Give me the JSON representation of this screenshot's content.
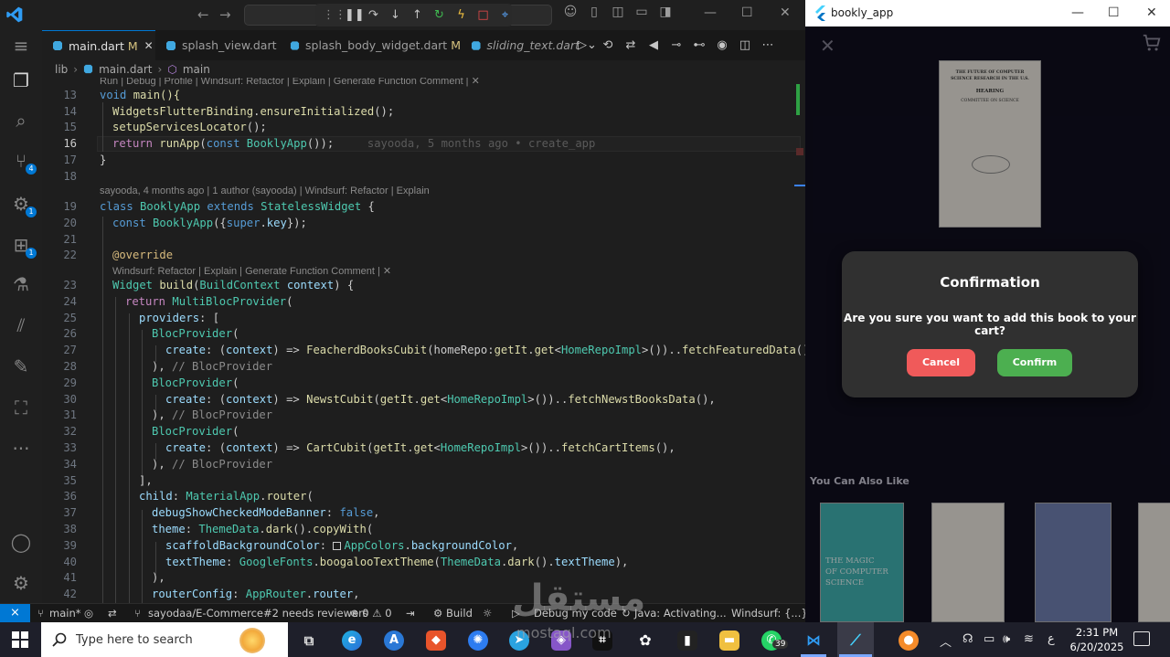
{
  "vscode": {
    "tabs": [
      {
        "label": "main.dart",
        "modified": "M"
      },
      {
        "label": "splash_view.dart"
      },
      {
        "label": "splash_body_widget.dart",
        "modified": "M"
      },
      {
        "label": "sliding_text.dart"
      }
    ],
    "breadcrumb": [
      "lib",
      "main.dart",
      "main"
    ],
    "activity_badges": [
      "4",
      "1",
      "1"
    ],
    "code_lens": [
      "Run | Debug | Profile | Windsurf: Refactor | Explain | Generate Function Comment | ✕",
      "sayooda, 4 months ago | 1 author (sayooda) | Windsurf: Refactor | Explain",
      "Windsurf: Refactor | Explain | Generate Function Comment | ✕"
    ],
    "blame": "sayooda, 5 months ago • create_app",
    "line_numbers": [
      "13",
      "14",
      "15",
      "16",
      "17",
      "18",
      "19",
      "20",
      "21",
      "22",
      "23",
      "24",
      "25",
      "26",
      "27",
      "28",
      "29",
      "30",
      "31",
      "32",
      "33",
      "34",
      "35",
      "36",
      "37",
      "38",
      "39",
      "40",
      "41",
      "42"
    ],
    "code": {
      "l13a": "void",
      "l13b": " main(){",
      "l14a": "WidgetsFlutterBinding",
      "l14b": ".",
      "l14c": "ensureInitialized",
      "l14d": "();",
      "l15a": "setupServicesLocator",
      "l15b": "();",
      "l16a": "return",
      "l16b": " ",
      "l16c": "runApp",
      "l16d": "(",
      "l16e": "const",
      "l16f": " ",
      "l16g": "BooklyApp",
      "l16h": "());",
      "l17": "}",
      "l19a": "class",
      "l19b": " ",
      "l19c": "BooklyApp",
      "l19d": " ",
      "l19e": "extends",
      "l19f": " ",
      "l19g": "StatelessWidget",
      "l19h": " {",
      "l20a": "const",
      "l20b": " ",
      "l20c": "BooklyApp",
      "l20d": "({",
      "l20e": "super",
      "l20f": ".",
      "l20g": "key",
      "l20h": "});",
      "l22": "@override",
      "l23a": "Widget",
      "l23b": " ",
      "l23c": "build",
      "l23d": "(",
      "l23e": "BuildContext",
      "l23f": " ",
      "l23g": "context",
      "l23h": ") {",
      "l24a": "return",
      "l24b": " ",
      "l24c": "MultiBlocProvider",
      "l24d": "(",
      "l25a": "providers",
      "l25b": ": [",
      "l26a": "BlocProvider",
      "l26b": "(",
      "l27a": "create",
      "l27b": ": (",
      "l27c": "context",
      "l27d": ") => ",
      "l27e": "FeacherdBooksCubit",
      "l27f": "(homeRepo:",
      "l27g": "getIt",
      "l27h": ".",
      "l27i": "get",
      "l27j": "<",
      "l27k": "HomeRepoImpl",
      "l27l": ">())..",
      "l27m": "fetchFeaturedData",
      "l27n": "(),",
      "l28a": "), ",
      "l28b": "// BlocProvider",
      "l29a": "BlocProvider",
      "l29b": "(",
      "l30a": "create",
      "l30b": ": (",
      "l30c": "context",
      "l30d": ") => ",
      "l30e": "NewstCubit",
      "l30f": "(",
      "l30g": "getIt",
      "l30h": ".",
      "l30i": "get",
      "l30j": "<",
      "l30k": "HomeRepoImpl",
      "l30l": ">())..",
      "l30m": "fetchNewstBooksData",
      "l30n": "(),",
      "l31a": "), ",
      "l31b": "// BlocProvider",
      "l32a": "BlocProvider",
      "l32b": "(",
      "l33a": "create",
      "l33b": ": (",
      "l33c": "context",
      "l33d": ") => ",
      "l33e": "CartCubit",
      "l33f": "(",
      "l33g": "getIt",
      "l33h": ".",
      "l33i": "get",
      "l33j": "<",
      "l33k": "HomeRepoImpl",
      "l33l": ">())..",
      "l33m": "fetchCartItems",
      "l33n": "(),",
      "l34a": "), ",
      "l34b": "// BlocProvider",
      "l35": "],",
      "l36a": "child",
      "l36b": ": ",
      "l36c": "MaterialApp",
      "l36d": ".",
      "l36e": "router",
      "l36f": "(",
      "l37a": "debugShowCheckedModeBanner",
      "l37b": ": ",
      "l37c": "false",
      "l37d": ",",
      "l38a": "theme",
      "l38b": ": ",
      "l38c": "ThemeData",
      "l38d": ".",
      "l38e": "dark",
      "l38f": "().",
      "l38g": "copyWith",
      "l38h": "(",
      "l39a": "scaffoldBackgroundColor",
      "l39b": ": ",
      "l39c": "AppColors",
      "l39d": ".",
      "l39e": "backgroundColor",
      "l39f": ",",
      "l40a": "textTheme",
      "l40b": ": ",
      "l40c": "GoogleFonts",
      "l40d": ".",
      "l40e": "boogalooTextTheme",
      "l40f": "(",
      "l40g": "ThemeData",
      "l40h": ".",
      "l40i": "dark",
      "l40j": "().",
      "l40k": "textTheme",
      "l40l": "),",
      "l41": "),",
      "l42a": "routerConfig",
      "l42b": ": ",
      "l42c": "AppRouter",
      "l42d": ".",
      "l42e": "router",
      "l42f": ","
    },
    "status": {
      "branch": "main*",
      "pr": "sayodaa/E-Commerce#2 needs reviewers",
      "problems": "⊗ 0 ⚠ 0",
      "build": "Build",
      "debug": "Debug my code",
      "java": "Java: Activating...",
      "windsurf": "Windsurf: {...}"
    }
  },
  "app": {
    "title": "bookly_app",
    "dialog_title": "Confirmation",
    "dialog_message": "Are you sure you want to add this book to your cart?",
    "cancel": "Cancel",
    "confirm": "Confirm",
    "section": "You Can Also Like",
    "main_book_lines": [
      "THE FUTURE OF COMPUTER",
      "SCIENCE RESEARCH IN THE U.S.",
      "HEARING",
      "COMMITTEE ON SCIENCE"
    ],
    "book2_lines": [
      "THE MAGIC",
      "OF COMPUTER",
      "SCIENCE"
    ]
  },
  "taskbar": {
    "search_placeholder": "Type here to search",
    "whatsapp_badge": "39",
    "ime": "ع",
    "time": "2:31 PM",
    "date": "6/20/2025"
  },
  "watermark": {
    "arabic": "مستقل",
    "latin": "mostaql.com"
  }
}
